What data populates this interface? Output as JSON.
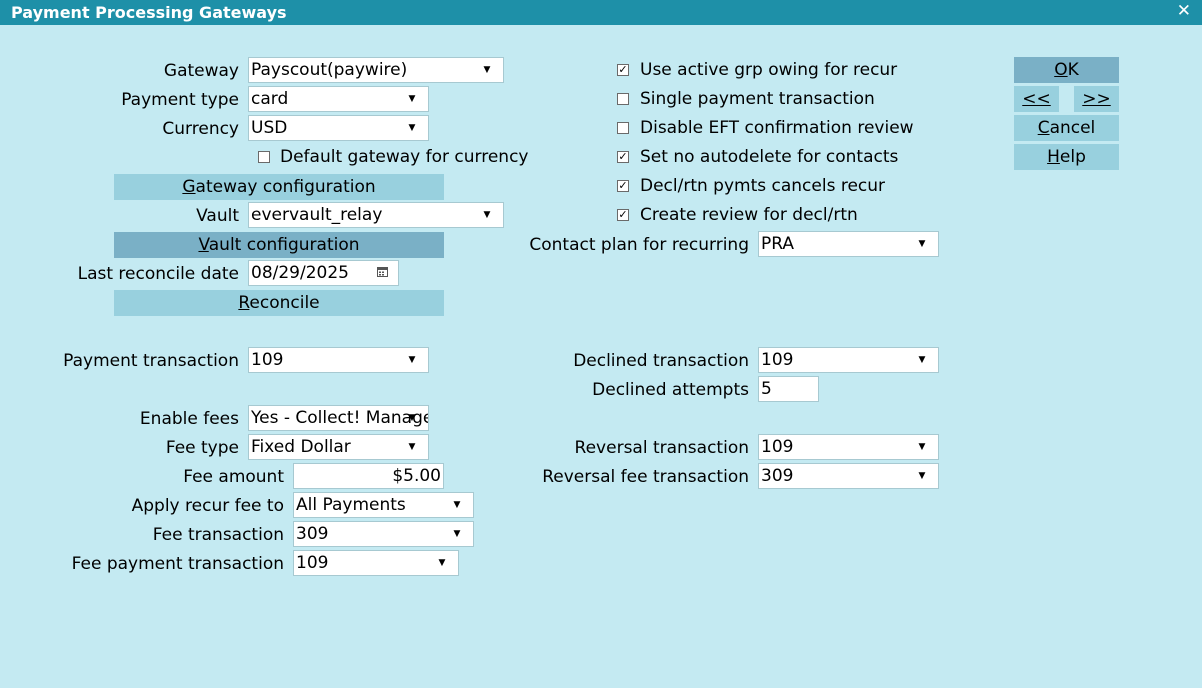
{
  "window": {
    "title": "Payment Processing Gateways",
    "close_glyph": "✕"
  },
  "left": {
    "gateway": {
      "label": "Gateway",
      "value": "Payscout(paywire)"
    },
    "payment_type": {
      "label": "Payment type",
      "value": "card"
    },
    "currency": {
      "label": "Currency",
      "value": "USD"
    },
    "default_gateway": {
      "label": "Default gateway for currency",
      "checked": false
    },
    "gateway_config": {
      "u": "G",
      "rest": "ateway configuration"
    },
    "vault": {
      "label": "Vault",
      "value": "evervault_relay"
    },
    "vault_config": {
      "u": "V",
      "rest": "ault configuration"
    },
    "last_reconcile": {
      "label": "Last reconcile date",
      "value": "08/29/2025"
    },
    "reconcile": {
      "u": "R",
      "rest": "econcile"
    },
    "payment_transaction": {
      "label": "Payment transaction",
      "value": "109"
    },
    "enable_fees": {
      "label": "Enable fees",
      "value": "Yes - Collect! Manage"
    },
    "fee_type": {
      "label": "Fee type",
      "value": "Fixed Dollar"
    },
    "fee_amount": {
      "label": "Fee amount",
      "value": "$5.00"
    },
    "apply_recur_fee": {
      "label": "Apply recur fee to",
      "value": "All Payments"
    },
    "fee_transaction": {
      "label": "Fee transaction",
      "value": "309"
    },
    "fee_payment_transaction": {
      "label": "Fee payment transaction",
      "value": "109"
    }
  },
  "right": {
    "checkboxes": [
      {
        "label": "Use active grp owing for recur",
        "checked": true
      },
      {
        "label": "Single payment transaction",
        "checked": false
      },
      {
        "label": "Disable EFT confirmation review",
        "checked": false
      },
      {
        "label": "Set no autodelete for contacts",
        "checked": true
      },
      {
        "label": "Decl/rtn pymts cancels recur",
        "checked": true
      },
      {
        "label": "Create review for decl/rtn",
        "checked": true
      }
    ],
    "contact_plan": {
      "label": "Contact plan for recurring",
      "value": "PRA"
    },
    "declined_transaction": {
      "label": "Declined transaction",
      "value": "109"
    },
    "declined_attempts": {
      "label": "Declined attempts",
      "value": "5"
    },
    "reversal_transaction": {
      "label": "Reversal transaction",
      "value": "109"
    },
    "reversal_fee_transaction": {
      "label": "Reversal fee transaction",
      "value": "309"
    }
  },
  "buttons": {
    "ok": {
      "u": "O",
      "rest": "K"
    },
    "prev": "<<",
    "next": ">>",
    "cancel": {
      "u": "C",
      "rest": "ancel"
    },
    "help": {
      "u": "H",
      "rest": "elp"
    }
  },
  "icons": {
    "dropdown": "chevron-down-icon",
    "calendar": "calendar-icon",
    "check": "checkmark-icon"
  },
  "colors": {
    "background": "#c4eaf2",
    "titlebar": "#1e90a8",
    "button": "#98d0de",
    "button_active": "#7ab0c6"
  }
}
